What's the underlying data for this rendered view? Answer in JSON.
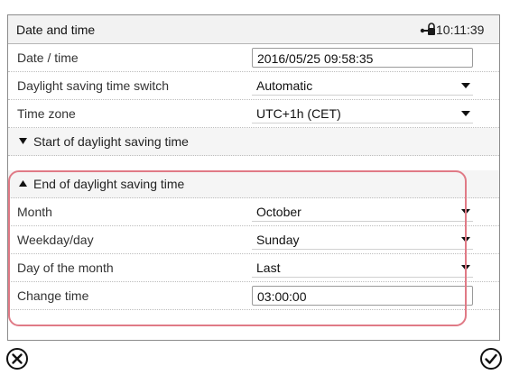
{
  "window": {
    "title": "Date and time",
    "clock": "10:11:39"
  },
  "rows": {
    "datetime": {
      "label": "Date / time",
      "value": "2016/05/25 09:58:35"
    },
    "dst_switch": {
      "label": "Daylight saving time switch",
      "value": "Automatic"
    },
    "timezone": {
      "label": "Time zone",
      "value": "UTC+1h (CET)"
    }
  },
  "sections": {
    "start_dst": {
      "label": "Start of daylight saving time",
      "expanded": false
    },
    "end_dst": {
      "label": "End of daylight saving time",
      "expanded": true
    }
  },
  "end_dst_rows": {
    "month": {
      "label": "Month",
      "value": "October"
    },
    "weekday": {
      "label": "Weekday/day",
      "value": "Sunday"
    },
    "day_of_month": {
      "label": "Day of the month",
      "value": "Last"
    },
    "change_time": {
      "label": "Change time",
      "value": "03:00:00"
    }
  },
  "footer": {
    "cancel_icon": "circle-x-icon",
    "confirm_icon": "circle-check-icon"
  },
  "colors": {
    "highlight": "#e07a86",
    "titlebar_bg": "#f2f2f2",
    "section_bg": "#f5f5f5"
  }
}
